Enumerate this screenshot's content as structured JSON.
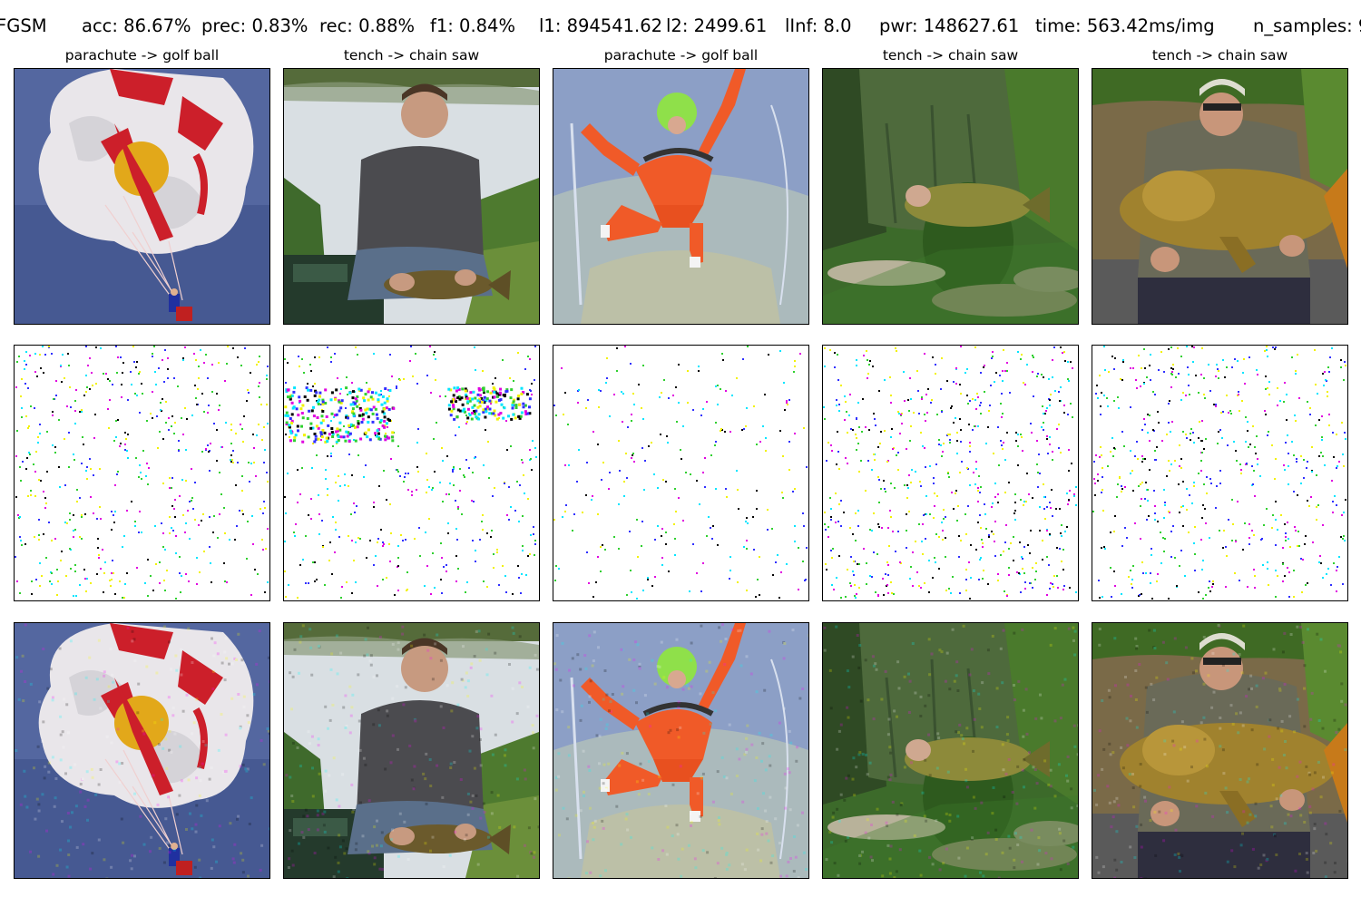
{
  "header": {
    "attack": "FGSM",
    "acc": "acc: 86.67%",
    "prec": "prec: 0.83%",
    "rec": "rec: 0.88%",
    "f1": "f1: 0.84%",
    "l1": "l1: 894541.62",
    "l2": "l2: 2499.61",
    "linf": "lInf: 8.0",
    "pwr": "pwr: 148627.61",
    "time": "time: 563.42ms/img",
    "n_samples": "n_samples: 9"
  },
  "columns": [
    {
      "title": "parachute -> golf ball",
      "subject": "parachute"
    },
    {
      "title": "tench -> chain saw",
      "subject": "man-with-fish-at-lake"
    },
    {
      "title": "parachute -> golf ball",
      "subject": "skydiver"
    },
    {
      "title": "tench -> chain saw",
      "subject": "fish-on-grass"
    },
    {
      "title": "tench -> chain saw",
      "subject": "man-with-carp"
    }
  ],
  "colors": {
    "perturb_cyan": "#00e5ff",
    "perturb_magenta": "#e000e0",
    "perturb_yellow": "#f2f200",
    "perturb_blue": "#3030ff",
    "perturb_green": "#30d030",
    "perturb_black": "#000000",
    "panel_border": "#000000"
  }
}
